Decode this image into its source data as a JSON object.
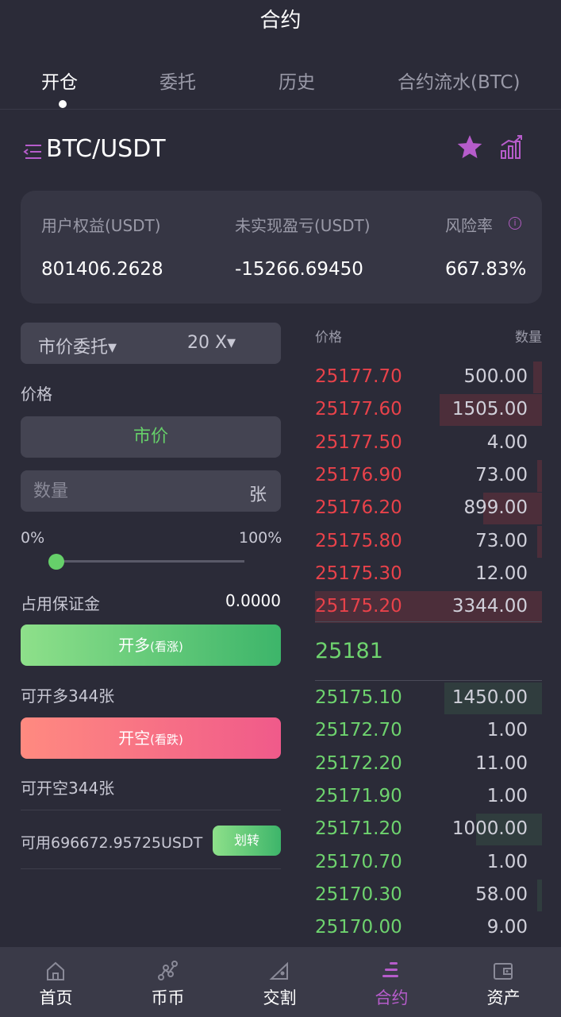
{
  "header": {
    "title": "合约"
  },
  "tabs": [
    {
      "label": "开仓",
      "active": true
    },
    {
      "label": "委托",
      "active": false
    },
    {
      "label": "历史",
      "active": false
    },
    {
      "label": "合约流水(BTC)",
      "active": false
    }
  ],
  "pair": {
    "name": "BTC/USDT",
    "menu_icon": "list-menu-icon",
    "favorite_icon": "star-icon",
    "chart_icon": "bar-chart-icon"
  },
  "account": {
    "equity_label": "用户权益(USDT)",
    "equity_value": "801406.2628",
    "pnl_label": "未实现盈亏(USDT)",
    "pnl_value": "-15266.69450",
    "risk_label": "风险率",
    "risk_value": "667.83%"
  },
  "order_form": {
    "order_type": "市价委托▾",
    "leverage": "20 X▾",
    "price_label": "价格",
    "market_label": "市价",
    "qty_placeholder": "数量",
    "qty_unit": "张",
    "pct_min": "0%",
    "pct_max": "100%",
    "slider_fraction": 0,
    "margin_label": "占用保证金",
    "margin_value": "0.0000",
    "long_label": "开多",
    "long_sub": "(看涨)",
    "long_available": "可开多344张",
    "short_label": "开空",
    "short_sub": "(看跌)",
    "short_available": "可开空344张",
    "available": "可用696672.95725USDT",
    "transfer_label": "划转"
  },
  "order_book": {
    "price_header": "价格",
    "qty_header": "数量",
    "asks": [
      {
        "price": "25177.70",
        "qty": "500.00",
        "depth": 0.04
      },
      {
        "price": "25177.60",
        "qty": "1505.00",
        "depth": 0.45
      },
      {
        "price": "25177.50",
        "qty": "4.00",
        "depth": 0
      },
      {
        "price": "25176.90",
        "qty": "73.00",
        "depth": 0.02
      },
      {
        "price": "25176.20",
        "qty": "899.00",
        "depth": 0.26
      },
      {
        "price": "25175.80",
        "qty": "73.00",
        "depth": 0.02
      },
      {
        "price": "25175.30",
        "qty": "12.00",
        "depth": 0
      },
      {
        "price": "25175.20",
        "qty": "3344.00",
        "depth": 1.0
      }
    ],
    "last_price": "25181",
    "bids": [
      {
        "price": "25175.10",
        "qty": "1450.00",
        "depth": 0.43
      },
      {
        "price": "25172.70",
        "qty": "1.00",
        "depth": 0
      },
      {
        "price": "25172.20",
        "qty": "11.00",
        "depth": 0
      },
      {
        "price": "25171.90",
        "qty": "1.00",
        "depth": 0
      },
      {
        "price": "25171.20",
        "qty": "1000.00",
        "depth": 0.29
      },
      {
        "price": "25170.70",
        "qty": "1.00",
        "depth": 0
      },
      {
        "price": "25170.30",
        "qty": "58.00",
        "depth": 0.02
      },
      {
        "price": "25170.00",
        "qty": "9.00",
        "depth": 0
      }
    ]
  },
  "nav": [
    {
      "label": "首页",
      "icon": "home-icon",
      "active": false
    },
    {
      "label": "币币",
      "icon": "nodes-icon",
      "active": false
    },
    {
      "label": "交割",
      "icon": "delivery-icon",
      "active": false
    },
    {
      "label": "合约",
      "icon": "contract-icon",
      "active": true
    },
    {
      "label": "资产",
      "icon": "wallet-icon",
      "active": false
    }
  ],
  "colors": {
    "background": "#2b2b38",
    "accent": "#b65ccb",
    "up": "#6ed36e",
    "down": "#e8424a"
  }
}
